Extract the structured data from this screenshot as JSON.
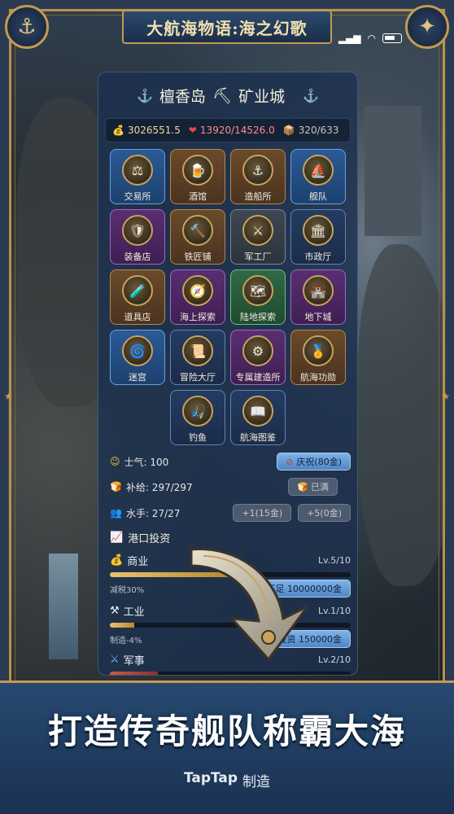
{
  "header": {
    "title": "大航海物语:海之幻歌",
    "corner_left_icon": "anchor-icon",
    "corner_right_icon": "compass-star-icon"
  },
  "status_bar": {
    "signal_icon": "signal-icon",
    "wifi_icon": "wifi-icon",
    "battery_icon": "battery-icon"
  },
  "panel": {
    "title_left": "檀香岛",
    "title_right": "矿业城",
    "resources": {
      "gold": "3026551.5",
      "health": "13920/14526.0",
      "materials": "320/633"
    },
    "buildings": [
      {
        "label": "交易所",
        "style": "blue",
        "icon": "⚖"
      },
      {
        "label": "酒馆",
        "style": "brown",
        "icon": "🍺"
      },
      {
        "label": "造船所",
        "style": "brown",
        "icon": "⚓"
      },
      {
        "label": "舰队",
        "style": "blue",
        "icon": "⛵"
      },
      {
        "label": "装备店",
        "style": "purple",
        "icon": "🛡"
      },
      {
        "label": "铁匠铺",
        "style": "brown",
        "icon": "🔨"
      },
      {
        "label": "军工厂",
        "style": "gray",
        "icon": "⚔"
      },
      {
        "label": "市政厅",
        "style": "navy",
        "icon": "🏛"
      },
      {
        "label": "道具店",
        "style": "brown",
        "icon": "🧪"
      },
      {
        "label": "海上探索",
        "style": "purple",
        "icon": "🧭"
      },
      {
        "label": "陆地探索",
        "style": "green",
        "icon": "🗺"
      },
      {
        "label": "地下城",
        "style": "purple",
        "icon": "🏰"
      },
      {
        "label": "迷宫",
        "style": "blue",
        "icon": "🌀"
      },
      {
        "label": "冒险大厅",
        "style": "navy",
        "icon": "📜"
      },
      {
        "label": "专属建造所",
        "style": "purple",
        "icon": "⚙"
      },
      {
        "label": "航海功勋",
        "style": "brown",
        "icon": "🏅"
      },
      {
        "label": "钓鱼",
        "style": "navy",
        "icon": "🎣"
      },
      {
        "label": "航海图鉴",
        "style": "navy",
        "icon": "📖"
      }
    ],
    "stats": {
      "morale_label": "士气: 100",
      "celebrate_button": "庆祝(80金)",
      "supply_label": "补给: 297/297",
      "supply_button": "已满",
      "sailors_label": "水手: 27/27",
      "sailor_btn_1": "+1(15金)",
      "sailor_btn_2": "+5(0金)"
    },
    "port_investment": {
      "heading": "港口投资",
      "items": [
        {
          "name": "商业",
          "level": "Lv.5/10",
          "progress": 0.5,
          "effect": "减税30%",
          "button": "不足 10000000金",
          "bar_color": "gold"
        },
        {
          "name": "工业",
          "level": "Lv.1/10",
          "progress": 0.1,
          "effect": "制造-4%",
          "button": "投资 150000金",
          "bar_color": "gold"
        },
        {
          "name": "军事",
          "level": "Lv.2/10",
          "progress": 0.2,
          "effect": "",
          "button": "",
          "bar_color": "red"
        }
      ]
    }
  },
  "bottom": {
    "slogan": "打造传奇舰队称霸大海",
    "maker_brand": "TapTap",
    "maker_suffix": "制造"
  }
}
